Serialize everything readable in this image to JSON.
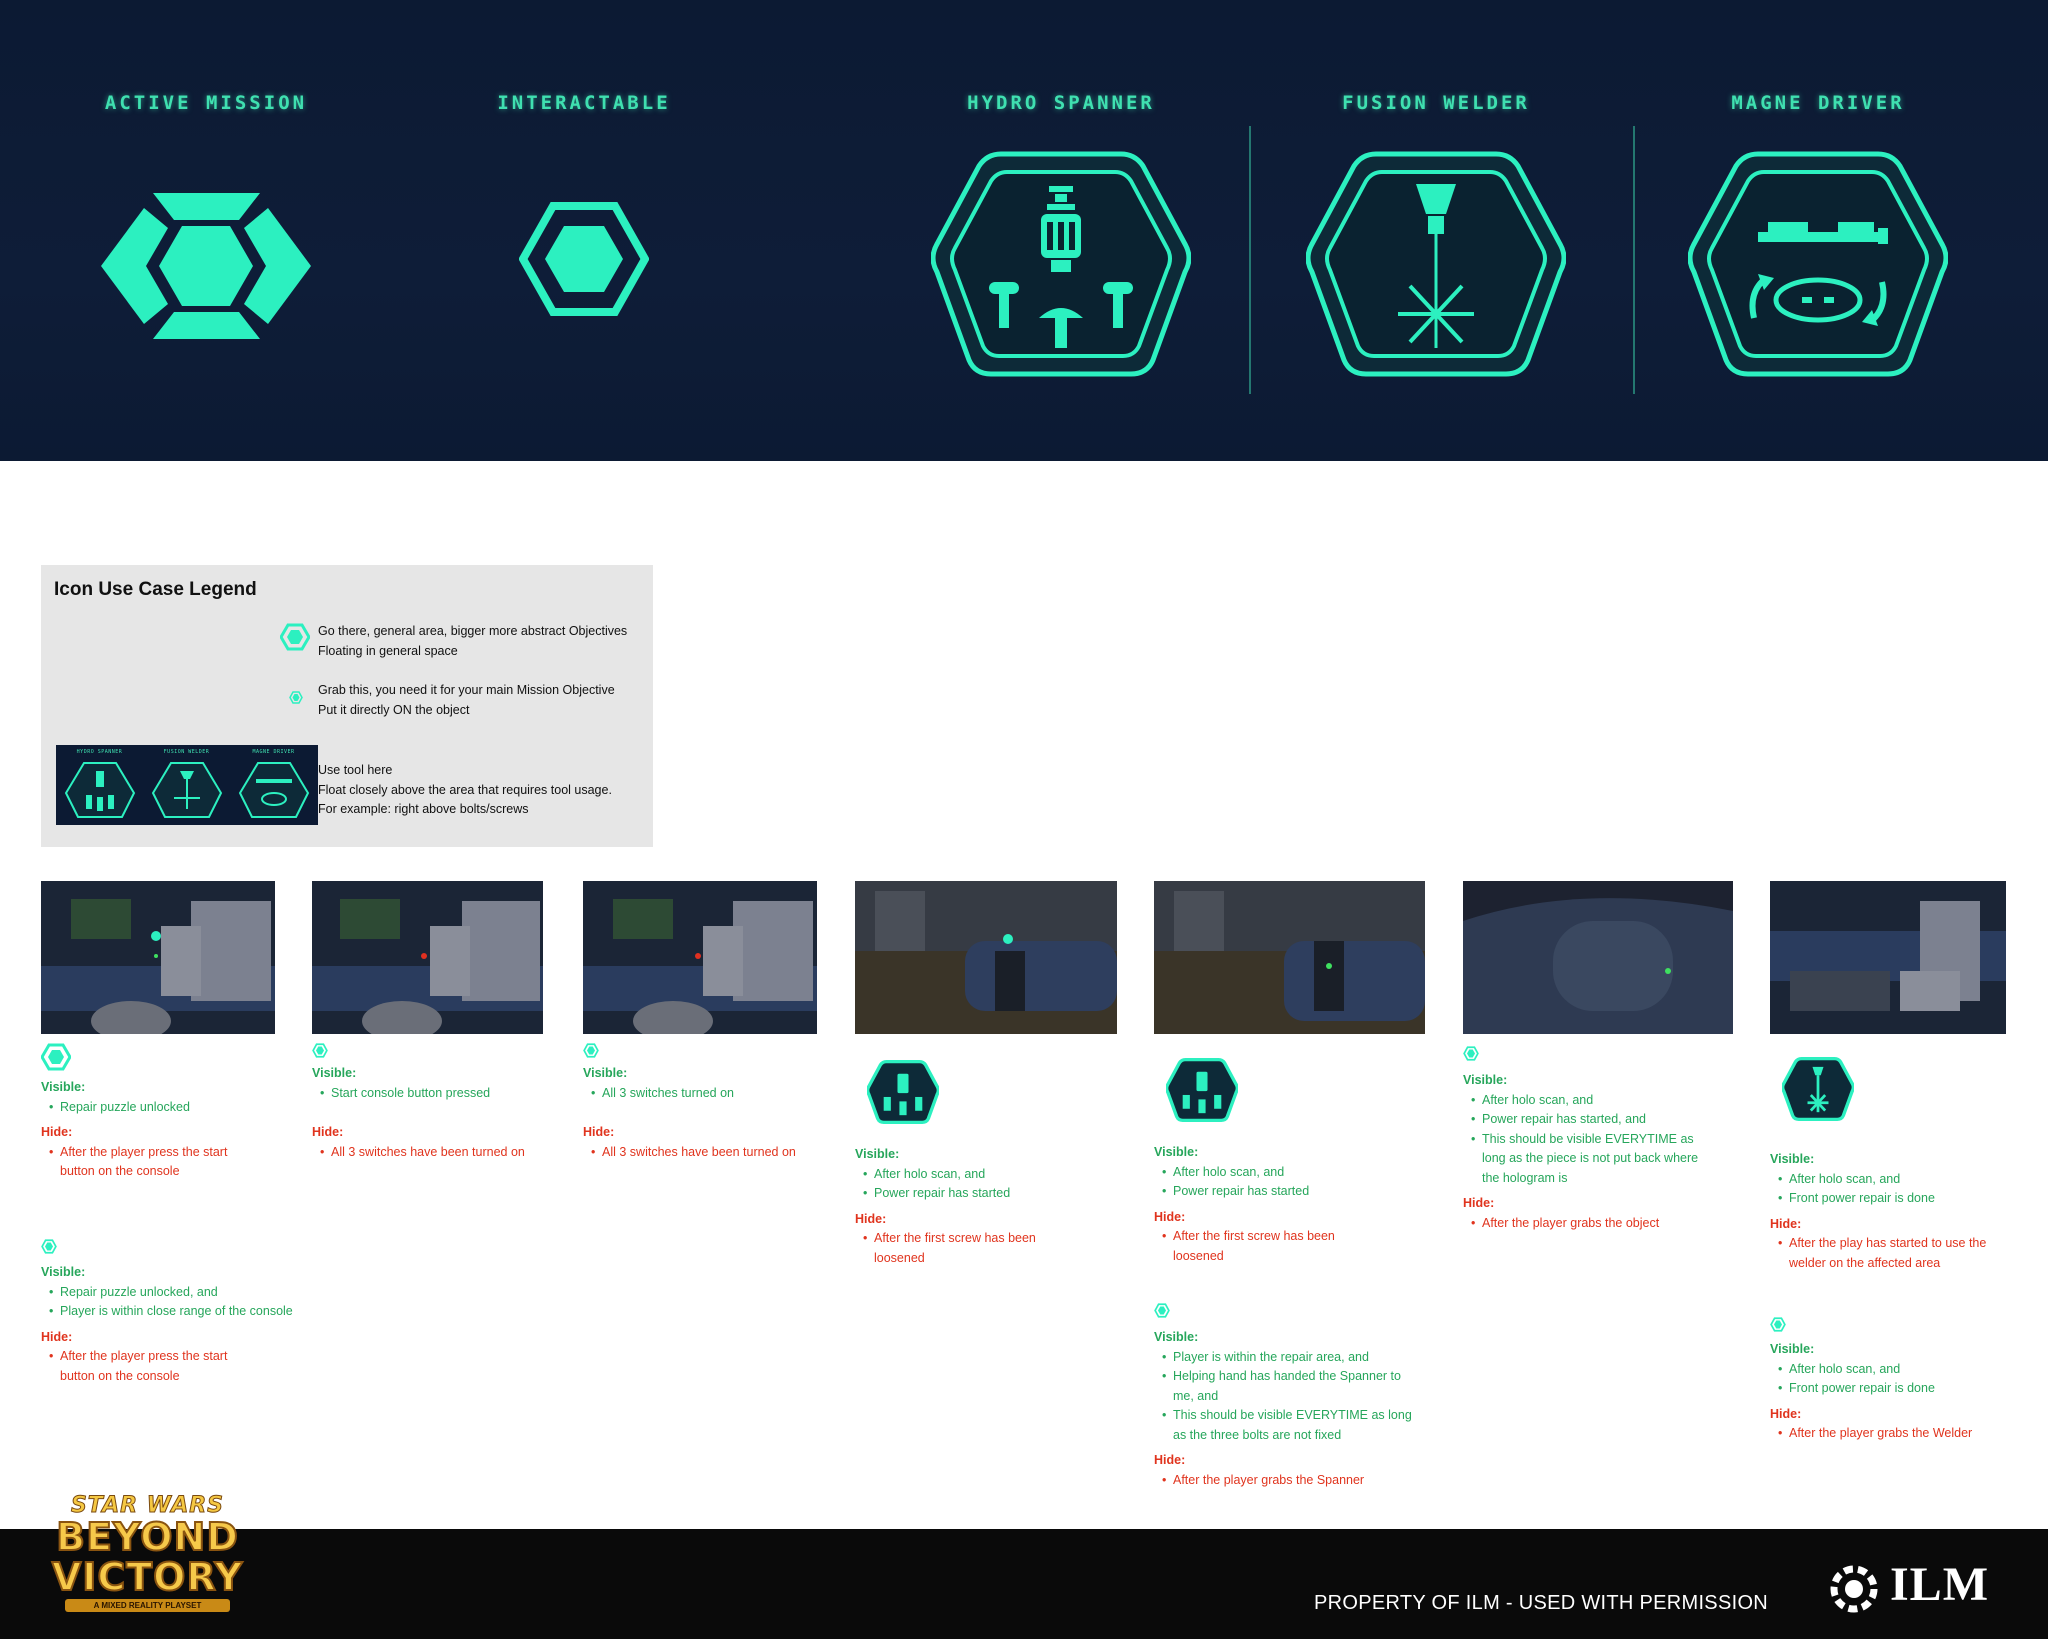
{
  "banner": {
    "active_mission": "ACTIVE MISSION",
    "interactable": "INTERACTABLE",
    "hydro_spanner": "HYDRO SPANNER",
    "fusion_welder": "FUSION WELDER",
    "magne_driver": "MAGNE DRIVER"
  },
  "legend": {
    "title": "Icon Use Case Legend",
    "row1_line1": "Go there, general area, bigger more abstract Objectives",
    "row1_line2": "Floating in general space",
    "row2_line1": "Grab this, you need it for your main Mission Objective",
    "row2_line2": "Put it directly ON the object",
    "row3_line1": "Use tool here",
    "row3_line2": "Float closely above the area that requires tool usage.",
    "row3_line3": "For example: right above bolts/screws",
    "thumb_labels": [
      "HYDRO SPANNER",
      "FUSION WELDER",
      "MAGNE DRIVER"
    ]
  },
  "labels": {
    "visible": "Visible:",
    "hide": "Hide:"
  },
  "columns": [
    {
      "blocks": [
        {
          "visible": [
            "Repair puzzle unlocked"
          ],
          "hide": [
            "After the player press the start button on the console"
          ]
        },
        {
          "visible": [
            "Repair puzzle unlocked, and",
            "Player is within close range of the console"
          ],
          "hide": [
            "After the player press the start button on the console"
          ]
        }
      ]
    },
    {
      "blocks": [
        {
          "visible": [
            "Start console button pressed"
          ],
          "hide": [
            "All 3 switches have been turned on"
          ]
        }
      ]
    },
    {
      "blocks": [
        {
          "visible": [
            "All 3 switches turned on"
          ],
          "hide": [
            "All 3 switches have been turned on"
          ]
        }
      ]
    },
    {
      "blocks": [
        {
          "visible": [
            "After holo scan, and",
            "Power repair has started"
          ],
          "hide": [
            "After the first screw has been loosened"
          ]
        }
      ]
    },
    {
      "blocks": [
        {
          "visible": [
            "After holo scan, and",
            "Power repair has started"
          ],
          "hide": [
            "After the first screw has been loosened"
          ]
        },
        {
          "visible": [
            "Player is within the repair area, and",
            "Helping hand has handed the Spanner to me, and",
            "This should be visible EVERYTIME as long as the three bolts are not fixed"
          ],
          "hide": [
            "After the player grabs the Spanner"
          ]
        }
      ]
    },
    {
      "blocks": [
        {
          "visible": [
            "After holo scan, and",
            "Power repair has started, and",
            "This should be visible EVERYTIME as long as the piece is not put back where the hologram is"
          ],
          "hide": [
            "After the player grabs the object"
          ]
        }
      ]
    },
    {
      "blocks": [
        {
          "visible": [
            "After holo scan, and",
            "Front power repair is done"
          ],
          "hide": [
            "After the play has started to use the welder on the affected area"
          ]
        },
        {
          "visible": [
            "After holo scan, and",
            "Front power repair is done"
          ],
          "hide": [
            "After the player grabs the Welder"
          ]
        }
      ]
    }
  ],
  "footer": {
    "property": "PROPERTY OF ILM - USED WITH PERMISSION",
    "ilm": "ILM",
    "logo_top": "STAR WARS",
    "logo_line1": "BEYOND",
    "logo_line2": "VICTORY",
    "logo_sub": "A MIXED REALITY PLAYSET"
  },
  "colors": {
    "accent": "#3fe0b0",
    "bright": "#2cf0c0",
    "visible": "#26a65b",
    "hide": "#e0341e",
    "banner": "#0c1a33"
  }
}
